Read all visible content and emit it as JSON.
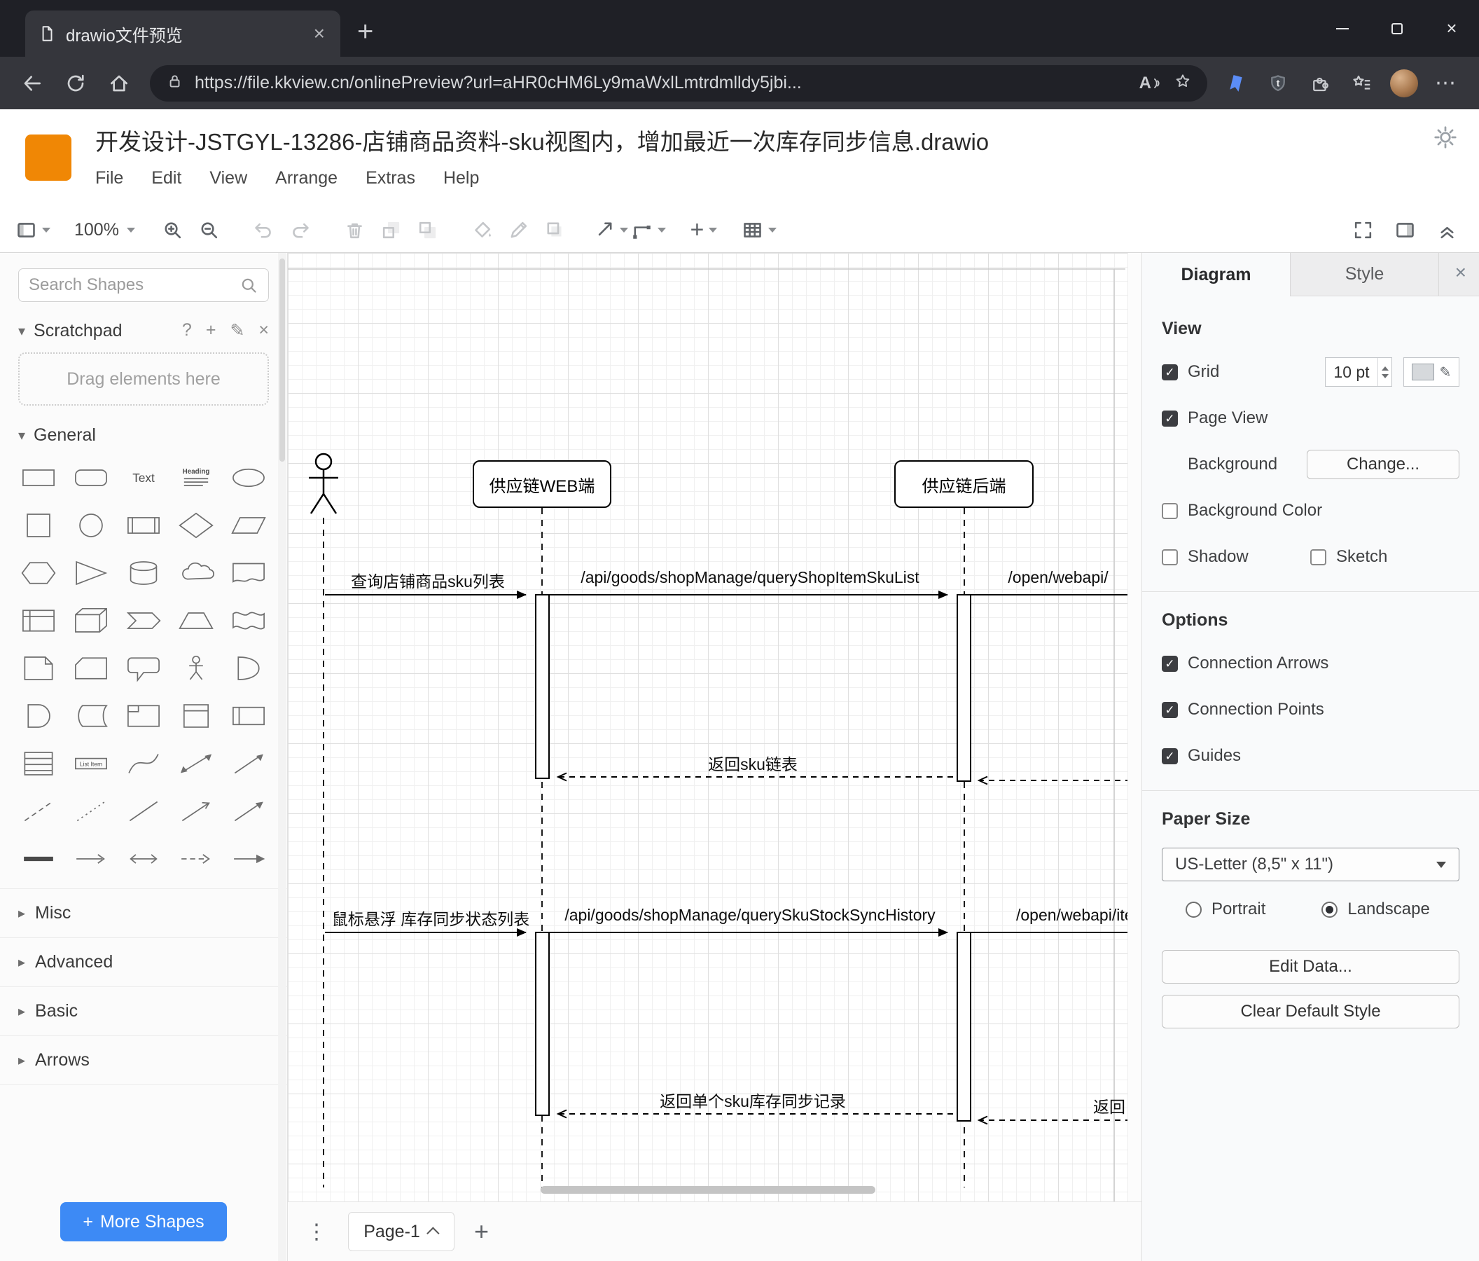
{
  "browser": {
    "tab_title": "drawio文件预览",
    "url": "https://file.kkview.cn/onlinePreview?url=aHR0cHM6Ly9maWxlLmtrdmlldy5jbi..."
  },
  "icons": {
    "tab_close": "×",
    "new_tab": "+",
    "window_close": "×",
    "read_aloud": "A",
    "shield_letter": "t",
    "more_menu": "⋯",
    "scratchpad_help": "?",
    "scratchpad_add": "+",
    "scratchpad_edit": "✎",
    "scratchpad_close": "×",
    "chevron_down": "▾",
    "chevron_right": "▸",
    "swatch_edit": "✎",
    "pages_menu": "⋮",
    "add_page": "+",
    "panel_close": "×",
    "insert_plus": "+",
    "more_shapes_plus": "+"
  },
  "header": {
    "title": "开发设计-JSTGYL-13286-店铺商品资料-sku视图内，增加最近一次库存同步信息.drawio",
    "menus": [
      "File",
      "Edit",
      "View",
      "Arrange",
      "Extras",
      "Help"
    ]
  },
  "toolbar": {
    "zoom": "100%"
  },
  "sidebar": {
    "search_placeholder": "Search Shapes",
    "scratchpad_title": "Scratchpad",
    "scratchpad_hint": "Drag elements here",
    "general_title": "General",
    "palette_labels": {
      "text": "Text",
      "heading": "Heading",
      "list_item": "List Item"
    },
    "shape_names": [
      "rectangle",
      "rounded-rectangle",
      "text",
      "textbox",
      "ellipse",
      "square",
      "circle",
      "process",
      "diamond",
      "parallelogram",
      "hexagon",
      "triangle",
      "cylinder",
      "cloud",
      "document",
      "internal-storage",
      "cube",
      "step",
      "trapezoid",
      "tape",
      "note",
      "card",
      "callout",
      "actor",
      "or",
      "and",
      "data-storage",
      "container",
      "vertical-container",
      "horizontal-container",
      "list",
      "list-item",
      "curve",
      "bidirectional-arrow",
      "arrow",
      "dashed-line",
      "dotted-line",
      "line",
      "arrow-open",
      "arrow-filled",
      "bold-line",
      "horizontal-arrow",
      "horizontal-bidirectional-arrow",
      "dashed-horizontal-arrow",
      "filled-horizontal-arrow"
    ],
    "sections": [
      "Misc",
      "Advanced",
      "Basic",
      "Arrows"
    ],
    "more_shapes_label": "More Shapes"
  },
  "canvas": {
    "participants": [
      "供应链WEB端",
      "供应链后端"
    ],
    "messages": {
      "m1": "查询店铺商品sku列表",
      "m2": "/api/goods/shopManage/queryShopItemSkuList",
      "m3": "/open/webapi/",
      "r1": "返回sku链表",
      "m4": "鼠标悬浮 库存同步状态列表",
      "m5": "/api/goods/shopManage/querySkuStockSyncHistory",
      "m6": "/open/webapi/item",
      "r2": "返回单个sku库存同步记录",
      "r3": "返回"
    },
    "page_tab": "Page-1"
  },
  "format": {
    "tabs": [
      "Diagram",
      "Style"
    ],
    "view_heading": "View",
    "grid_label": "Grid",
    "grid_size": "10 pt",
    "page_view_label": "Page View",
    "background_label": "Background",
    "change_button": "Change...",
    "background_color_label": "Background Color",
    "shadow_label": "Shadow",
    "sketch_label": "Sketch",
    "options_heading": "Options",
    "connection_arrows_label": "Connection Arrows",
    "connection_points_label": "Connection Points",
    "guides_label": "Guides",
    "paper_heading": "Paper Size",
    "paper_value": "US-Letter (8,5\" x 11\")",
    "portrait_label": "Portrait",
    "landscape_label": "Landscape",
    "edit_data_button": "Edit Data...",
    "clear_style_button": "Clear Default Style",
    "states": {
      "grid": true,
      "page_view": true,
      "background_color": false,
      "shadow": false,
      "sketch": false,
      "connection_arrows": true,
      "connection_points": true,
      "guides": true,
      "orientation": "landscape"
    }
  },
  "colors": {
    "accent_blue": "#3d8af5",
    "logo_orange": "#f08705",
    "grid_swatch": "#d6d9dc"
  }
}
